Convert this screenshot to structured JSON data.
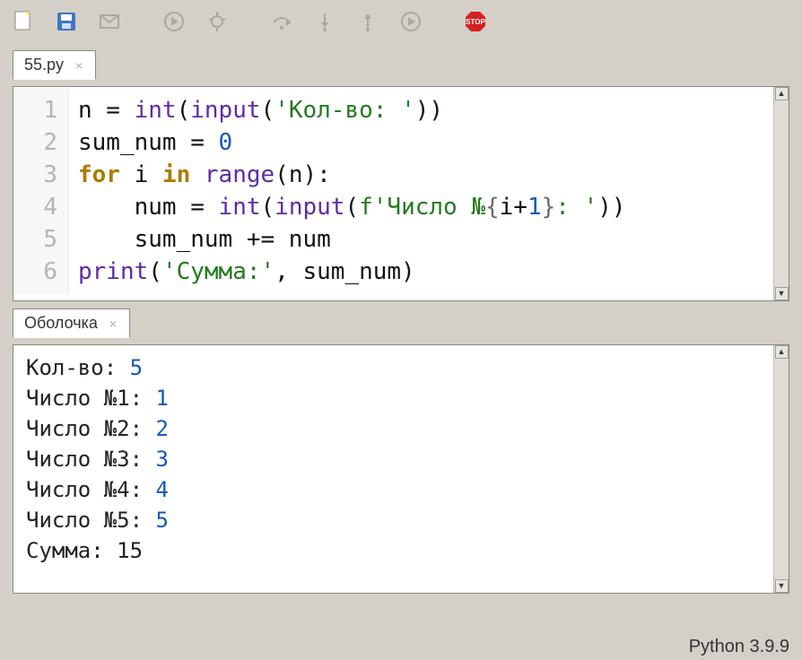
{
  "toolbar": {
    "icons": [
      "new-file",
      "save",
      "mail",
      "run",
      "debug",
      "step-over",
      "step-into",
      "step-out",
      "continue",
      "stop"
    ]
  },
  "editor": {
    "tab_label": "55.py",
    "line_numbers": [
      "1",
      "2",
      "3",
      "4",
      "5",
      "6"
    ],
    "code": {
      "l1_a": "n = ",
      "l1_fn1": "int",
      "l1_b": "(",
      "l1_fn2": "input",
      "l1_c": "(",
      "l1_str": "'Кол-во: '",
      "l1_d": "))",
      "l2_a": "sum_num = ",
      "l2_num": "0",
      "l3_kw1": "for",
      "l3_a": " i ",
      "l3_kw2": "in",
      "l3_b": " ",
      "l3_fn": "range",
      "l3_c": "(n):",
      "l4_a": "    num = ",
      "l4_fn1": "int",
      "l4_b": "(",
      "l4_fn2": "input",
      "l4_c": "(",
      "l4_str1": "f'Число №",
      "l4_open": "{",
      "l4_expr": "i+",
      "l4_num": "1",
      "l4_close": "}",
      "l4_str2": ": '",
      "l4_d": "))",
      "l5_a": "    sum_num += num",
      "l6_fn": "print",
      "l6_a": "(",
      "l6_str": "'Сумма:'",
      "l6_b": ", sum_num)"
    }
  },
  "shell": {
    "tab_label": "Оболочка",
    "lines": [
      {
        "prompt": "Кол-во: ",
        "input": "5"
      },
      {
        "prompt": "Число №1: ",
        "input": "1"
      },
      {
        "prompt": "Число №2: ",
        "input": "2"
      },
      {
        "prompt": "Число №3: ",
        "input": "3"
      },
      {
        "prompt": "Число №4: ",
        "input": "4"
      },
      {
        "prompt": "Число №5: ",
        "input": "5"
      },
      {
        "prompt": "Сумма: 15",
        "input": ""
      }
    ]
  },
  "statusbar": {
    "text": "Python 3.9.9"
  }
}
